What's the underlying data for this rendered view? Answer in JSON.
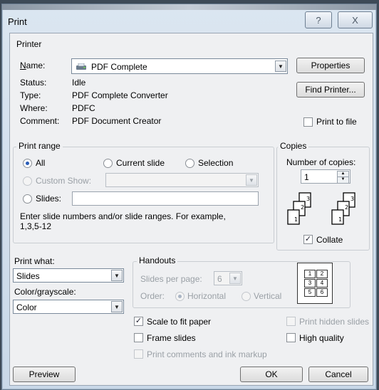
{
  "window": {
    "title": "Print",
    "help_label": "?",
    "close_label": "X"
  },
  "printer": {
    "group_label": "Printer",
    "name_label": "Name:",
    "name_value": "PDF Complete",
    "status_label": "Status:",
    "status_value": "Idle",
    "type_label": "Type:",
    "type_value": "PDF Complete Converter",
    "where_label": "Where:",
    "where_value": "PDFC",
    "comment_label": "Comment:",
    "comment_value": "PDF Document Creator",
    "properties_label": "Properties",
    "find_printer_label": "Find Printer...",
    "print_to_file_label": "Print to file"
  },
  "print_range": {
    "group_label": "Print range",
    "all_label": "All",
    "current_slide_label": "Current slide",
    "selection_label": "Selection",
    "custom_show_label": "Custom Show:",
    "slides_label": "Slides:",
    "hint": "Enter slide numbers and/or slide ranges. For example,",
    "hint_example": "1,3,5-12"
  },
  "copies": {
    "group_label": "Copies",
    "number_label": "Number of copies:",
    "number_value": "1",
    "collate_label": "Collate"
  },
  "print_what": {
    "label": "Print what:",
    "value": "Slides"
  },
  "color": {
    "label": "Color/grayscale:",
    "value": "Color"
  },
  "handouts": {
    "group_label": "Handouts",
    "slides_per_page_label": "Slides per page:",
    "slides_per_page_value": "6",
    "order_label": "Order:",
    "horizontal_label": "Horizontal",
    "vertical_label": "Vertical",
    "preview_numbers": [
      "1",
      "2",
      "3",
      "4",
      "5",
      "6"
    ]
  },
  "options": {
    "scale_to_fit_label": "Scale to fit paper",
    "frame_slides_label": "Frame slides",
    "print_comments_label": "Print comments and ink markup",
    "print_hidden_label": "Print hidden slides",
    "high_quality_label": "High quality"
  },
  "buttons": {
    "preview": "Preview",
    "ok": "OK",
    "cancel": "Cancel"
  }
}
